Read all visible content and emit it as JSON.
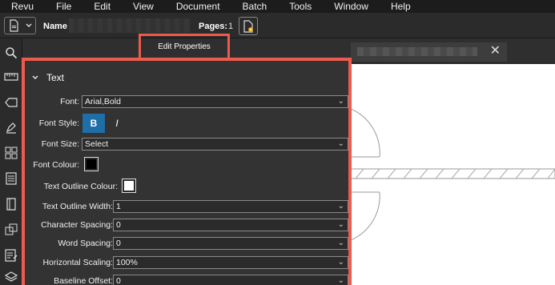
{
  "menu": [
    "Revu",
    "File",
    "Edit",
    "View",
    "Document",
    "Batch",
    "Tools",
    "Window",
    "Help"
  ],
  "toolbar": {
    "name_label": "Name",
    "pages_label": "Pages:",
    "pages_value": "1"
  },
  "panel": {
    "title": "Edit Properties",
    "section": "Text",
    "font_label": "Font:",
    "font_value": "Arial,Bold",
    "font_style_label": "Font Style:",
    "bold_label": "B",
    "italic_label": "I",
    "font_size_label": "Font Size:",
    "font_size_value": "Select",
    "font_colour_label": "Font Colour:",
    "font_colour": "#000000",
    "outline_colour_label": "Text Outline Colour:",
    "outline_colour": "#ffffff",
    "outline_width_label": "Text Outline Width:",
    "outline_width_value": "1",
    "char_spacing_label": "Character Spacing:",
    "char_spacing_value": "0",
    "word_spacing_label": "Word Spacing:",
    "word_spacing_value": "0",
    "hscale_label": "Horizontal Scaling:",
    "hscale_value": "100%",
    "baseline_label": "Baseline Offset:",
    "baseline_value": "0"
  },
  "colors": {
    "highlight": "#ec5b4c",
    "bold_active": "#1f6ea8"
  },
  "icons": [
    "search-icon",
    "ruler-icon",
    "tag-icon",
    "pen-icon",
    "thumbnails-icon",
    "list-icon",
    "book-icon",
    "layers-icon",
    "form-icon",
    "stack-icon"
  ]
}
